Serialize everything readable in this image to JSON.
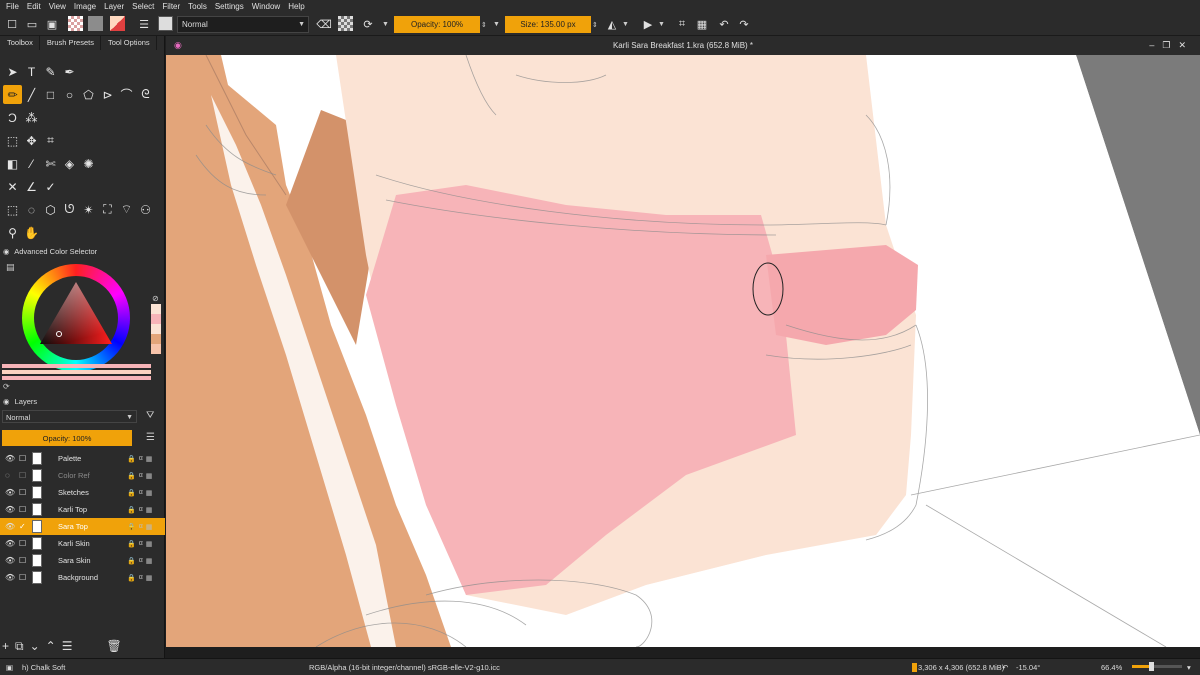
{
  "menu": [
    "File",
    "Edit",
    "View",
    "Image",
    "Layer",
    "Select",
    "Filter",
    "Tools",
    "Settings",
    "Window",
    "Help"
  ],
  "toolbar": {
    "blend_mode": "Normal",
    "opacity_label": "Opacity: 100%",
    "size_label": "Size: 135.00 px"
  },
  "docker_tabs": [
    "Toolbox",
    "Brush Presets",
    "Tool Options"
  ],
  "color_selector": {
    "title": "Advanced Color Selector"
  },
  "layers_panel": {
    "title": "Layers",
    "blend_mode": "Normal",
    "opacity_label": "Opacity: 100%",
    "layers": [
      {
        "name": "Palette",
        "visible": true,
        "active": false
      },
      {
        "name": "Color Ref",
        "visible": false,
        "active": false
      },
      {
        "name": "Sketches",
        "visible": true,
        "active": false
      },
      {
        "name": "Karli Top",
        "visible": true,
        "active": false
      },
      {
        "name": "Sara Top",
        "visible": true,
        "active": true
      },
      {
        "name": "Karli Skin",
        "visible": true,
        "active": false
      },
      {
        "name": "Sara Skin",
        "visible": true,
        "active": false
      },
      {
        "name": "Background",
        "visible": true,
        "active": false
      }
    ]
  },
  "document": {
    "title": "Karli Sara Breakfast 1.kra (652.8 MiB) *"
  },
  "status": {
    "brush": "h) Chalk Soft",
    "color_profile": "RGB/Alpha (16-bit integer/channel)  sRGB-elle-V2-g10.icc",
    "dimensions": "3,306 x 4,306 (652.8 MiB)",
    "rotation": "-15.04°",
    "zoom": "66.4%"
  },
  "colors": {
    "accent": "#f0a20a",
    "panel": "#2b2b2b",
    "skin_dark": "#e3a57a",
    "skin_light": "#fbe3d4",
    "top_pink": "#f7b4b8"
  },
  "icons": {
    "layers": [
      "eye-icon",
      "eye-hidden-icon",
      "eye-icon",
      "eye-icon",
      "eye-icon",
      "eye-icon",
      "eye-icon",
      "eye-icon"
    ]
  }
}
